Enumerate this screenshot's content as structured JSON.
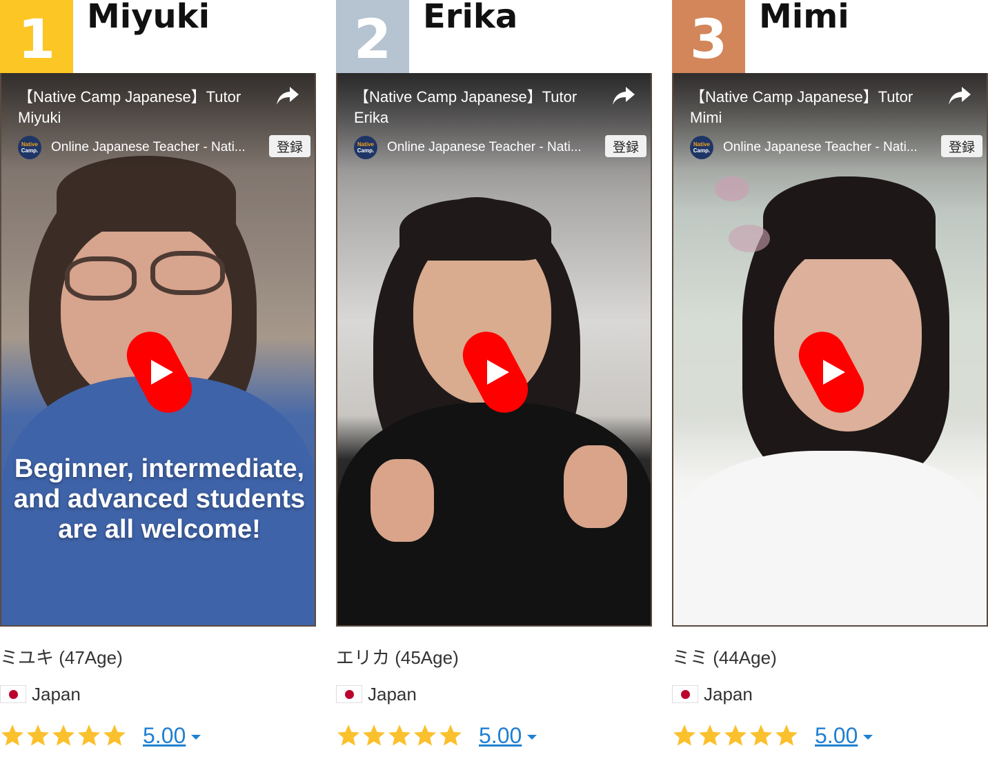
{
  "colors": {
    "rank_1": "#fcc625",
    "rank_2": "#b6c3d0",
    "rank_3": "#d2865a",
    "play_red": "#ff0000",
    "star": "#fbc02d",
    "rating_link": "#1f7fd0"
  },
  "tutors": [
    {
      "rank": "1",
      "name": "Miyuki",
      "video_title": "【Native Camp Japanese】Tutor Miyuki",
      "channel_name": "Online Japanese Teacher - Nati...",
      "subscribe_label": "登録",
      "caption": "Beginner, intermediate, and advanced students are all welcome!",
      "age_line": "ミユキ (47Age)",
      "country": "Japan",
      "rating": "5.00",
      "stars": 5
    },
    {
      "rank": "2",
      "name": "Erika",
      "video_title": "【Native Camp Japanese】Tutor Erika",
      "channel_name": "Online Japanese Teacher - Nati...",
      "subscribe_label": "登録",
      "caption": "",
      "age_line": "エリカ (45Age)",
      "country": "Japan",
      "rating": "5.00",
      "stars": 5
    },
    {
      "rank": "3",
      "name": "Mimi",
      "video_title": "【Native Camp Japanese】Tutor Mimi",
      "channel_name": "Online Japanese Teacher - Nati...",
      "subscribe_label": "登録",
      "caption": "",
      "age_line": "ミミ (44Age)",
      "country": "Japan",
      "rating": "5.00",
      "stars": 5
    }
  ],
  "channel_logo": {
    "line1": "Native",
    "line2": "Camp."
  },
  "icons": {
    "share": "share-arrow-icon",
    "play": "youtube-shorts-play-icon",
    "flag": "japan-flag-icon",
    "star": "star-icon",
    "caret": "caret-down-icon"
  }
}
